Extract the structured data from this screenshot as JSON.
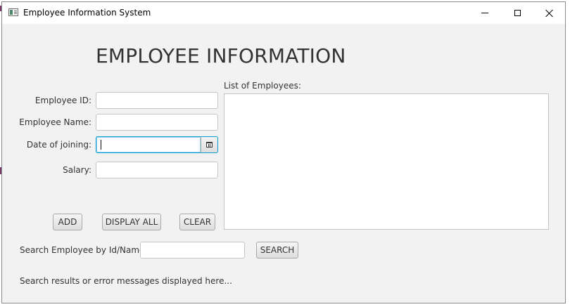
{
  "window": {
    "title": "Employee Information System",
    "icon": "app-window-icon",
    "controls": [
      "minimize-icon",
      "maximize-icon",
      "close-icon"
    ]
  },
  "form": {
    "heading": "EMPLOYEE INFORMATION",
    "employee_id": {
      "label": "Employee ID:",
      "value": ""
    },
    "employee_name": {
      "label": "Employee Name:",
      "value": ""
    },
    "date_of_joining": {
      "label": "Date of joining:",
      "value": "",
      "picker_icon": "calendar-icon"
    },
    "salary": {
      "label": "Salary:",
      "value": ""
    }
  },
  "list": {
    "label": "List of Employees:",
    "items": []
  },
  "buttons": {
    "add": "ADD",
    "display_all": "DISPLAY ALL",
    "clear": "CLEAR",
    "search": "SEARCH"
  },
  "search": {
    "label": "Search Employee by Id/Name:",
    "value": ""
  },
  "status": {
    "message": "Search results or error messages displayed here..."
  },
  "colors": {
    "window_bg": "#f2f2f2",
    "focus_border": "#039ed3",
    "text": "#333333"
  }
}
